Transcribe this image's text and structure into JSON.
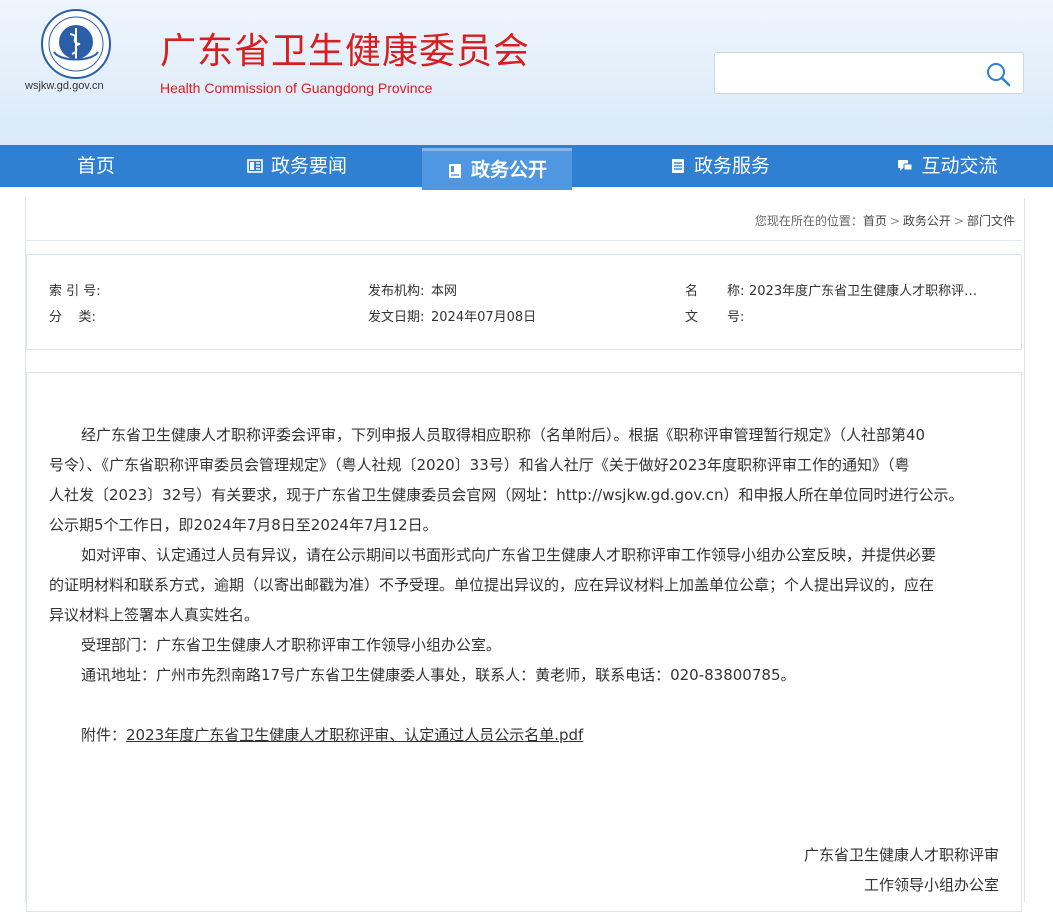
{
  "header": {
    "domain": "wsjkw.gd.gov.cn",
    "title": "广东省卫生健康委员会",
    "subtitle": "Health Commission of Guangdong Province",
    "search": {
      "value": "",
      "placeholder": ""
    }
  },
  "nav": {
    "items": [
      {
        "label": "首页",
        "icon": ""
      },
      {
        "label": "政务要闻",
        "icon": "news-icon"
      },
      {
        "label": "政务公开",
        "icon": "book-icon",
        "active": true
      },
      {
        "label": "政务服务",
        "icon": "document-icon"
      },
      {
        "label": "互动交流",
        "icon": "chat-icon"
      }
    ]
  },
  "breadcrumb": {
    "prefix": "您现在所在的位置：",
    "items": [
      "首页",
      "政务公开",
      "部门文件"
    ],
    "separator": ">"
  },
  "meta": {
    "index_label": "索 引 号:",
    "index_value": "",
    "category_label": "分    类:",
    "category_value": "",
    "publisher_label": "发布机构:",
    "publisher_value": "本网",
    "date_label": "发文日期:",
    "date_value": "2024年07月08日",
    "name_label_1": "名",
    "name_label_2": "称:",
    "name_value": "2023年度广东省卫生健康人才职称评…",
    "docno_label_1": "文",
    "docno_label_2": "号:",
    "docno_value": ""
  },
  "article": {
    "p1_l1": "经广东省卫生健康人才职称评委会评审，下列申报人员取得相应职称（名单附后）。根据《职称评审管理暂行规定》（人社部第40",
    "p1_l2": "号令）、《广东省职称评审委员会管理规定》（粤人社规〔2020〕33号）和省人社厅《关于做好2023年度职称评审工作的通知》（粤",
    "p1_l3": "人社发〔2023〕32号）有关要求，现于广东省卫生健康委员会官网（网址：http://wsjkw.gd.gov.cn）和申报人所在单位同时进行公示。",
    "p1_l4": "公示期5个工作日，即2024年7月8日至2024年7月12日。",
    "p2_l1": "如对评审、认定通过人员有异议，请在公示期间以书面形式向广东省卫生健康人才职称评审工作领导小组办公室反映，并提供必要",
    "p2_l2": "的证明材料和联系方式，逾期（以寄出邮戳为准）不予受理。单位提出异议的，应在异议材料上加盖单位公章；个人提出异议的，应在",
    "p2_l3": "异议材料上签署本人真实姓名。",
    "p3": "受理部门：广东省卫生健康人才职称评审工作领导小组办公室。",
    "p4": "通讯地址：广州市先烈南路17号广东省卫生健康委人事处，联系人：黄老师，联系电话：020-83800785。",
    "attachment_label": "附件：",
    "attachment_link": "2023年度广东省卫生健康人才职称评审、认定通过人员公示名单.pdf",
    "sign_1": "广东省卫生健康人才职称评审",
    "sign_2": "工作领导小组办公室"
  },
  "colors": {
    "brand_red": "#d81e1e",
    "nav_blue": "#2f7fd3",
    "nav_active": "#4f97e0"
  }
}
